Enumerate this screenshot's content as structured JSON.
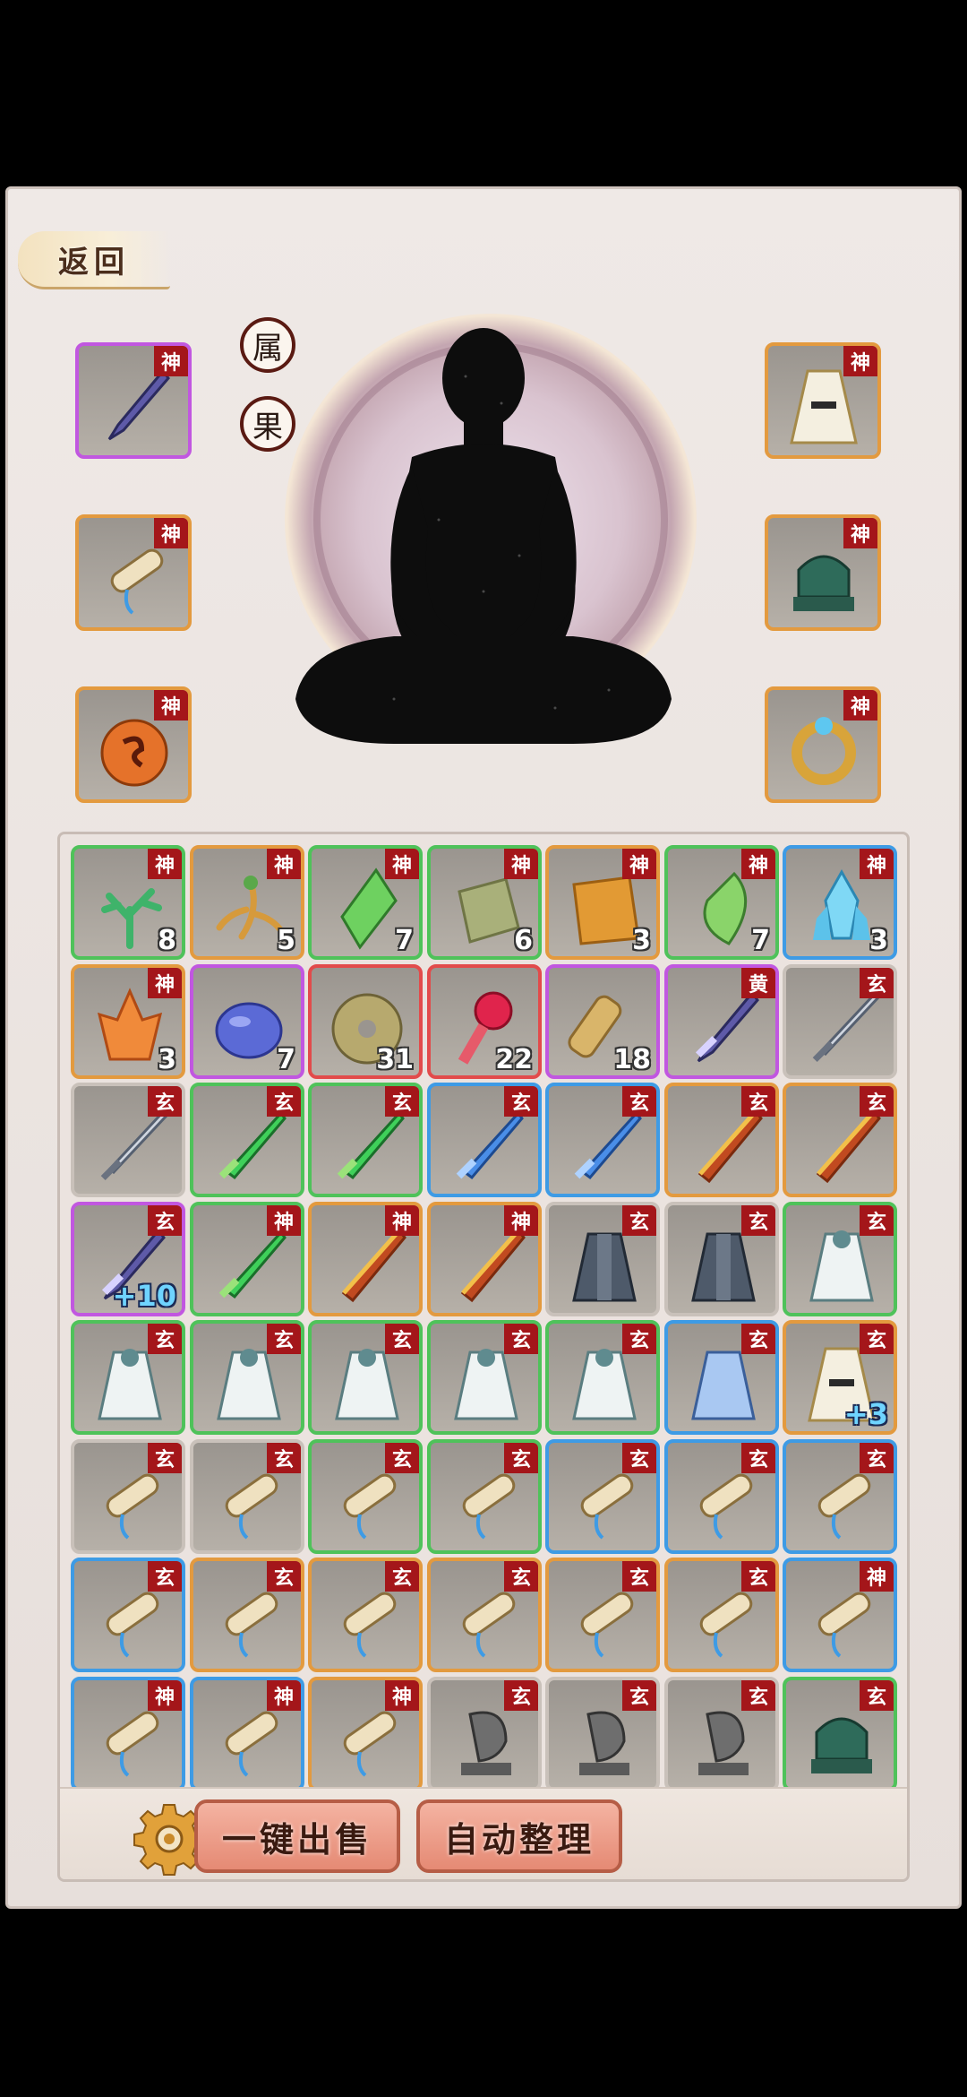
{
  "back_label": "返回",
  "side_buttons": [
    "属",
    "果"
  ],
  "equip_tag": "神",
  "equipment": {
    "left": [
      {
        "name": "sword-icon",
        "rarity": "purple"
      },
      {
        "name": "scroll-icon",
        "rarity": "orange"
      },
      {
        "name": "pouch-icon",
        "rarity": "orange"
      }
    ],
    "right": [
      {
        "name": "robe-icon",
        "rarity": "orange"
      },
      {
        "name": "jade-beast-icon",
        "rarity": "orange"
      },
      {
        "name": "ring-icon",
        "rarity": "orange"
      }
    ]
  },
  "inventory": [
    {
      "icon": "coral-icon",
      "rarity": "green",
      "tag": "神",
      "count": "8"
    },
    {
      "icon": "ginseng-icon",
      "rarity": "orange",
      "tag": "神",
      "count": "5"
    },
    {
      "icon": "green-crystal-icon",
      "rarity": "green",
      "tag": "神",
      "count": "7"
    },
    {
      "icon": "map-cloth-icon",
      "rarity": "green",
      "tag": "神",
      "count": "6"
    },
    {
      "icon": "orange-cloth-icon",
      "rarity": "orange",
      "tag": "神",
      "count": "3"
    },
    {
      "icon": "green-gem-icon",
      "rarity": "green",
      "tag": "神",
      "count": "7"
    },
    {
      "icon": "blue-crystal-icon",
      "rarity": "blue",
      "tag": "神",
      "count": "3"
    },
    {
      "icon": "flame-crystal-icon",
      "rarity": "orange",
      "tag": "神",
      "count": "3"
    },
    {
      "icon": "blue-stone-icon",
      "rarity": "purple",
      "tag": "",
      "count": "7"
    },
    {
      "icon": "jade-disc-icon",
      "rarity": "red",
      "tag": "",
      "count": "31"
    },
    {
      "icon": "red-key-icon",
      "rarity": "red",
      "tag": "",
      "count": "22"
    },
    {
      "icon": "bundle-icon",
      "rarity": "purple",
      "tag": "",
      "count": "18"
    },
    {
      "icon": "purple-sword-icon",
      "rarity": "purple",
      "tag": "黄",
      "count": ""
    },
    {
      "icon": "steel-sword-icon",
      "rarity": "gray",
      "tag": "玄",
      "count": ""
    },
    {
      "icon": "steel-sword-icon",
      "rarity": "gray",
      "tag": "玄",
      "count": ""
    },
    {
      "icon": "green-sword-icon",
      "rarity": "green",
      "tag": "玄",
      "count": ""
    },
    {
      "icon": "green-sword-icon",
      "rarity": "green",
      "tag": "玄",
      "count": ""
    },
    {
      "icon": "blue-sword-icon",
      "rarity": "blue",
      "tag": "玄",
      "count": ""
    },
    {
      "icon": "blue-sword-icon",
      "rarity": "blue",
      "tag": "玄",
      "count": ""
    },
    {
      "icon": "gold-sword-icon",
      "rarity": "orange",
      "tag": "玄",
      "count": ""
    },
    {
      "icon": "gold-sword-icon",
      "rarity": "orange",
      "tag": "玄",
      "count": ""
    },
    {
      "icon": "purple-sword-icon",
      "rarity": "purple",
      "tag": "玄",
      "count": "",
      "plus": "+10"
    },
    {
      "icon": "green-sword-icon",
      "rarity": "green",
      "tag": "神",
      "count": ""
    },
    {
      "icon": "gold-sword-icon",
      "rarity": "orange",
      "tag": "神",
      "count": ""
    },
    {
      "icon": "gold-sword-icon",
      "rarity": "orange",
      "tag": "神",
      "count": ""
    },
    {
      "icon": "dark-robe-icon",
      "rarity": "gray",
      "tag": "玄",
      "count": ""
    },
    {
      "icon": "dark-robe-icon",
      "rarity": "gray",
      "tag": "玄",
      "count": ""
    },
    {
      "icon": "white-robe-icon",
      "rarity": "green",
      "tag": "玄",
      "count": ""
    },
    {
      "icon": "white-robe-icon",
      "rarity": "green",
      "tag": "玄",
      "count": ""
    },
    {
      "icon": "white-robe-icon",
      "rarity": "green",
      "tag": "玄",
      "count": ""
    },
    {
      "icon": "white-robe-icon",
      "rarity": "green",
      "tag": "玄",
      "count": ""
    },
    {
      "icon": "white-robe-icon",
      "rarity": "green",
      "tag": "玄",
      "count": ""
    },
    {
      "icon": "white-robe-icon",
      "rarity": "green",
      "tag": "玄",
      "count": ""
    },
    {
      "icon": "blue-robe-icon",
      "rarity": "blue",
      "tag": "玄",
      "count": ""
    },
    {
      "icon": "robe-icon",
      "rarity": "orange",
      "tag": "玄",
      "count": "",
      "plus": "+3"
    },
    {
      "icon": "scroll-icon",
      "rarity": "gray",
      "tag": "玄",
      "count": ""
    },
    {
      "icon": "scroll-icon",
      "rarity": "gray",
      "tag": "玄",
      "count": ""
    },
    {
      "icon": "scroll-icon",
      "rarity": "green",
      "tag": "玄",
      "count": ""
    },
    {
      "icon": "scroll-icon",
      "rarity": "green",
      "tag": "玄",
      "count": ""
    },
    {
      "icon": "scroll-icon",
      "rarity": "blue",
      "tag": "玄",
      "count": ""
    },
    {
      "icon": "scroll-icon",
      "rarity": "blue",
      "tag": "玄",
      "count": ""
    },
    {
      "icon": "scroll-icon",
      "rarity": "blue",
      "tag": "玄",
      "count": ""
    },
    {
      "icon": "scroll-icon",
      "rarity": "blue",
      "tag": "玄",
      "count": ""
    },
    {
      "icon": "scroll-icon",
      "rarity": "orange",
      "tag": "玄",
      "count": ""
    },
    {
      "icon": "scroll-icon",
      "rarity": "orange",
      "tag": "玄",
      "count": ""
    },
    {
      "icon": "scroll-icon",
      "rarity": "orange",
      "tag": "玄",
      "count": ""
    },
    {
      "icon": "scroll-icon",
      "rarity": "orange",
      "tag": "玄",
      "count": ""
    },
    {
      "icon": "scroll-icon",
      "rarity": "orange",
      "tag": "玄",
      "count": ""
    },
    {
      "icon": "scroll-icon",
      "rarity": "blue",
      "tag": "神",
      "count": ""
    },
    {
      "icon": "scroll-icon",
      "rarity": "blue",
      "tag": "神",
      "count": ""
    },
    {
      "icon": "scroll-icon",
      "rarity": "blue",
      "tag": "神",
      "count": ""
    },
    {
      "icon": "scroll-icon",
      "rarity": "orange",
      "tag": "神",
      "count": ""
    },
    {
      "icon": "fish-statue-icon",
      "rarity": "gray",
      "tag": "玄",
      "count": ""
    },
    {
      "icon": "fish-statue-icon",
      "rarity": "gray",
      "tag": "玄",
      "count": ""
    },
    {
      "icon": "fish-statue-icon",
      "rarity": "gray",
      "tag": "玄",
      "count": ""
    },
    {
      "icon": "jade-beast-icon",
      "rarity": "green",
      "tag": "玄",
      "count": ""
    }
  ],
  "buttons": {
    "settings": "settings-gear-icon",
    "sell_all": "一键出售",
    "auto_sort": "自动整理"
  }
}
